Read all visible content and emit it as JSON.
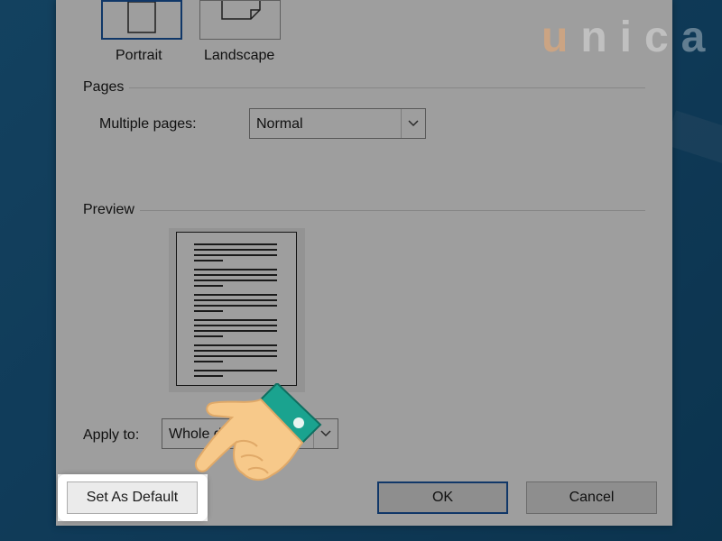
{
  "dialog": {
    "orientation": {
      "portrait_label": "Portrait",
      "landscape_label": "Landscape"
    },
    "pages": {
      "title": "Pages",
      "multiple_pages_label": "Multiple pages:",
      "multiple_pages_value": "Normal"
    },
    "preview": {
      "title": "Preview"
    },
    "apply_to": {
      "label": "Apply to:",
      "value": "Whole d"
    },
    "buttons": {
      "set_default": "Set As Default",
      "ok": "OK",
      "cancel": "Cancel"
    }
  },
  "watermark": {
    "first": "u",
    "rest": "nica"
  },
  "colors": {
    "accent": "#1a5aa8",
    "desktop": "#1a5f8f",
    "cuff": "#1aa38f",
    "skin": "#f7c98a"
  }
}
